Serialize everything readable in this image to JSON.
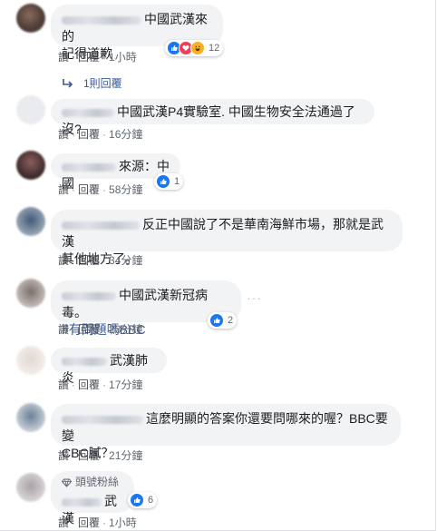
{
  "comments": [
    {
      "text": "中國武漢來的",
      "text2": "記得道歉",
      "like": "讚",
      "reply": "回覆",
      "time": "1小時",
      "reactions": "12"
    },
    {
      "text": "中國武漢P4實驗室. 中國生物安全法通過了沒?",
      "like": "讚",
      "reply": "回覆",
      "time": "16分鐘"
    },
    {
      "text": "來源：中國",
      "like": "讚",
      "reply": "回覆",
      "time": "58分鐘",
      "reactions": "1"
    },
    {
      "text": "反正中國說了不是華南海鮮市場，那就是武漢",
      "text2": "其他地方了。",
      "like": "讚",
      "reply": "回覆",
      "time": "34分鐘"
    },
    {
      "text": "中國武漢新冠病毒。",
      "hashtag": "#有問題嗎BBC",
      "like": "讚",
      "reply": "回覆",
      "time": "23分鐘",
      "reactions": "2"
    },
    {
      "text": "武漢肺炎",
      "like": "讚",
      "reply": "回覆",
      "time": "17分鐘"
    },
    {
      "text": "這麼明顯的答案你還要問哪來的喔？BBC要變",
      "text2": "CBC膩？",
      "like": "讚",
      "reply": "回覆",
      "time": "21分鐘"
    },
    {
      "badge": "頭號粉絲",
      "text": "武漢",
      "like": "讚",
      "reply": "回覆",
      "time": "1小時",
      "reactions": "6"
    }
  ],
  "replies_link": "1則回覆",
  "colors": {
    "like": "#1877f2",
    "love": "#f33e58",
    "haha": "#f7b125",
    "link": "#385898"
  }
}
